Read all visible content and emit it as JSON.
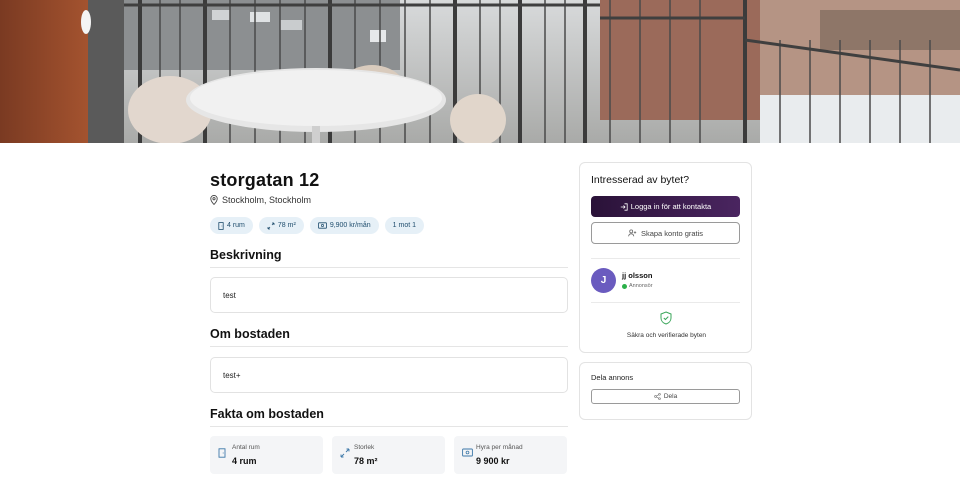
{
  "listing": {
    "title": "storgatan 12",
    "location": "Stockholm, Stockholm",
    "tags": [
      {
        "icon": "door-icon",
        "label": "4 rum"
      },
      {
        "icon": "expand-icon",
        "label": "78 m²"
      },
      {
        "icon": "banknote-icon",
        "label": "9,900 kr/mån"
      },
      {
        "icon": "",
        "label": "1 mot 1"
      }
    ]
  },
  "sections": {
    "description": {
      "heading": "Beskrivning",
      "text": "test"
    },
    "about": {
      "heading": "Om bostaden",
      "text": "test+"
    },
    "facts": {
      "heading": "Fakta om bostaden",
      "items": [
        {
          "icon": "door-icon",
          "label": "Antal rum",
          "value": "4 rum"
        },
        {
          "icon": "expand-icon",
          "label": "Storlek",
          "value": "78 m²"
        },
        {
          "icon": "banknote-icon",
          "label": "Hyra per månad",
          "value": "9 900 kr"
        }
      ]
    }
  },
  "sidebar": {
    "contact_card": {
      "title": "Intresserad av bytet?",
      "login_button": "Logga in för att kontakta",
      "signup_button": "Skapa konto gratis",
      "user": {
        "initial": "J",
        "name": "jj olsson",
        "role": "Annonsör"
      },
      "secure_text": "Säkra och verifierade byten"
    },
    "share_card": {
      "title": "Dela annons",
      "share_button": "Dela"
    }
  },
  "colors": {
    "primary_button": "#3a1a4e",
    "avatar": "#6a5bbf",
    "tag_bg": "#e6f0f7",
    "online_dot": "#2bb04a",
    "shield": "#3aa65a"
  }
}
